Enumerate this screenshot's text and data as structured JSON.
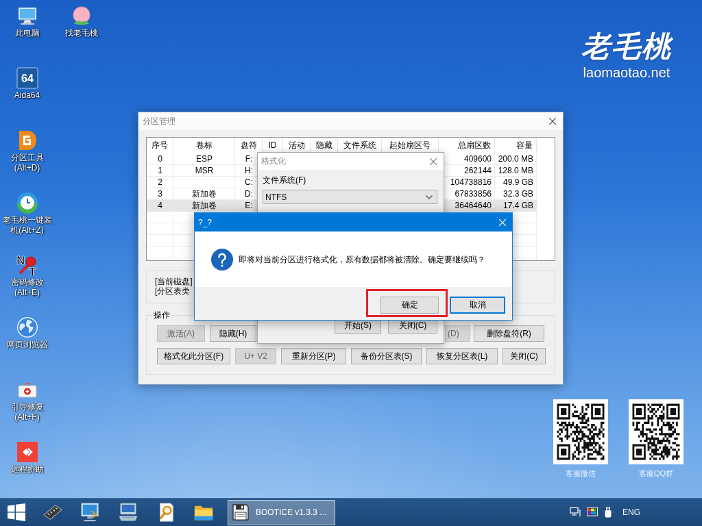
{
  "desktop": {
    "icons": [
      {
        "label": "此电脑"
      },
      {
        "label": "找老毛桃"
      },
      {
        "label": "Aida64",
        "icon_text": [
          "64"
        ]
      },
      {
        "label": "分区工具(Alt+D)"
      },
      {
        "label": "老毛桃一键装机(Alt+Z)"
      },
      {
        "label": "密码修改(Alt+E)",
        "icon_text": [
          "N",
          "T"
        ]
      },
      {
        "label": "网页浏览器"
      },
      {
        "label": "引导修复(Alt+F)"
      },
      {
        "label": "远程协助"
      }
    ],
    "wallpaper_logo": {
      "name": "老毛桃",
      "site": "laomaotao.net"
    },
    "qr_codes": [
      {
        "caption": "客服微信"
      },
      {
        "caption": "客服QQ群"
      }
    ]
  },
  "partition_window": {
    "title": "分区管理",
    "table": {
      "columns": [
        "序号",
        "卷标",
        "盘符",
        "ID",
        "活动",
        "隐藏",
        "文件系统",
        "起始扇区号",
        "总扇区数",
        "容量"
      ],
      "rows": [
        {
          "index": "0",
          "label": "ESP",
          "drive": "F:",
          "total_sectors": "409600",
          "capacity": "200.0 MB",
          "selected": false
        },
        {
          "index": "1",
          "label": "MSR",
          "drive": "H:",
          "total_sectors": "262144",
          "capacity": "128.0 MB",
          "selected": false
        },
        {
          "index": "2",
          "drive": "C:",
          "total_sectors": "104738816",
          "capacity": "49.9 GB",
          "selected": false
        },
        {
          "index": "3",
          "label": "新加卷",
          "drive": "D:",
          "total_sectors": "67833856",
          "capacity": "32.3 GB",
          "selected": false
        },
        {
          "index": "4",
          "label": "新加卷",
          "drive": "E:",
          "total_sectors": "36464640",
          "capacity": "17.4 GB",
          "selected": true
        }
      ]
    },
    "disk_info": [
      "[当前磁盘]",
      "[分区表类"
    ],
    "operations": {
      "title": "操作",
      "upper_left_buttons": [
        {
          "label": "激活(A)",
          "disabled": true
        },
        {
          "label": "隐藏(H)",
          "disabled": false
        }
      ],
      "upper_right_buttons": [
        {
          "label": "(D)",
          "disabled": true
        },
        {
          "label": "删除盘符(R)",
          "disabled": false
        }
      ],
      "lower_buttons": [
        {
          "label": "格式化此分区(F)",
          "disabled": false
        },
        {
          "label": "U+ V2",
          "disabled": true
        },
        {
          "label": "重新分区(P)",
          "disabled": false
        },
        {
          "label": "备份分区表(S)",
          "disabled": false
        },
        {
          "label": "恢复分区表(L)",
          "disabled": false
        },
        {
          "label": "关闭(C)",
          "disabled": false
        }
      ]
    }
  },
  "format_dialog": {
    "title": "格式化",
    "file_system_label": "文件系统(F)",
    "file_system": "NTFS",
    "buttons": [
      {
        "label": "开始(S)"
      },
      {
        "label": "关闭(C)"
      }
    ]
  },
  "confirm_dialog": {
    "title": "?_?",
    "message": "即将对当前分区进行格式化，原有数据都将被清除。确定要继续吗？",
    "buttons": [
      {
        "label": "确定",
        "default": false,
        "highlighted": true
      },
      {
        "label": "取消",
        "default": true,
        "highlighted": false
      }
    ]
  },
  "taskbar": {
    "tasks": [
      {
        "label": "BOOTICE v1.3.3 ...",
        "active": true
      }
    ],
    "language": "ENG"
  }
}
